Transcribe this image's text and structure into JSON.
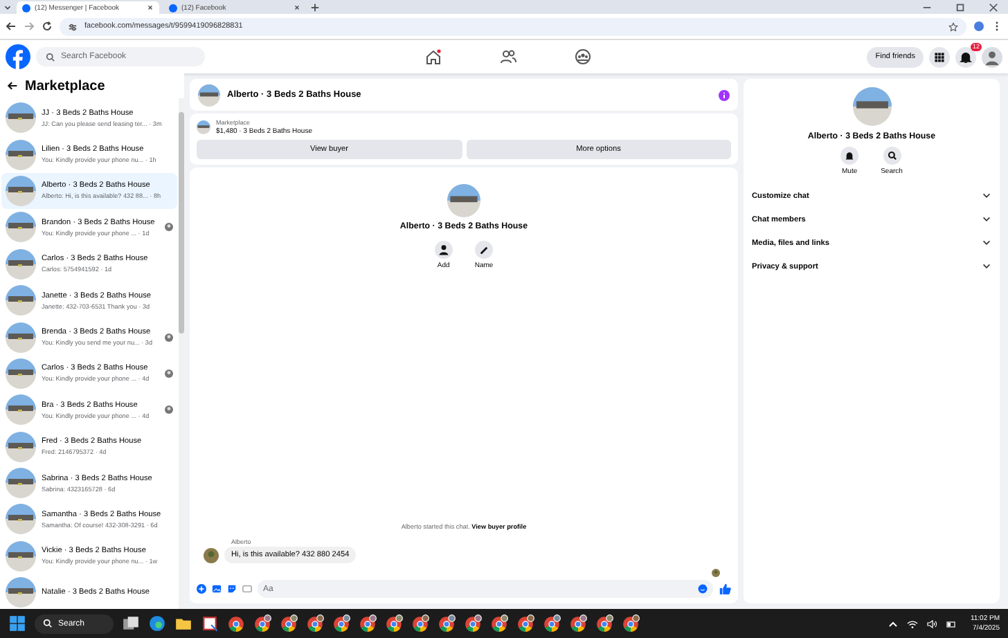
{
  "browser": {
    "tabs": [
      {
        "title": "(12) Messenger | Facebook",
        "selected": true
      },
      {
        "title": "(12) Facebook",
        "selected": false
      }
    ],
    "url": "facebook.com/messages/t/9599419096828831"
  },
  "topbar": {
    "search_placeholder": "Search Facebook",
    "find_friends": "Find friends",
    "notification_count": "12"
  },
  "sidebar": {
    "title": "Marketplace",
    "conversations": [
      {
        "title": "JJ · 3 Beds 2 Baths House",
        "preview": "JJ: Can you please send leasing ter... · 3m",
        "selected": false,
        "seen": false
      },
      {
        "title": "Lilien · 3 Beds 2 Baths House",
        "preview": "You: Kindly provide your phone nu... · 1h",
        "selected": false,
        "seen": false
      },
      {
        "title": "Alberto · 3 Beds 2 Baths House",
        "preview": "Alberto: Hi, is this available? 432 88... · 8h",
        "selected": true,
        "seen": false
      },
      {
        "title": "Brandon · 3 Beds 2 Baths House",
        "preview": "You: Kindly provide your phone ... · 1d",
        "selected": false,
        "seen": true
      },
      {
        "title": "Carlos · 3 Beds 2 Baths House",
        "preview": "Carlos: 5754941592 · 1d",
        "selected": false,
        "seen": false
      },
      {
        "title": "Janette · 3 Beds 2 Baths House",
        "preview": "Janette: 432-703-6531 Thank you · 3d",
        "selected": false,
        "seen": false
      },
      {
        "title": "Brenda · 3 Beds 2 Baths House",
        "preview": "You: Kindly you send me your nu... · 3d",
        "selected": false,
        "seen": true
      },
      {
        "title": "Carlos · 3 Beds 2 Baths House",
        "preview": "You: Kindly provide your phone ... · 4d",
        "selected": false,
        "seen": true
      },
      {
        "title": "Bra · 3 Beds 2 Baths House",
        "preview": "You: Kindly provide your phone ... · 4d",
        "selected": false,
        "seen": true
      },
      {
        "title": "Fred · 3 Beds 2 Baths House",
        "preview": "Fred: 2146795372 · 4d",
        "selected": false,
        "seen": false
      },
      {
        "title": "Sabrina · 3 Beds 2 Baths House",
        "preview": "Sabrina: 4323165728 · 6d",
        "selected": false,
        "seen": false
      },
      {
        "title": "Samantha · 3 Beds 2 Baths House",
        "preview": "Samantha: Of course! 432-308-3291 · 6d",
        "selected": false,
        "seen": false
      },
      {
        "title": "Vickie · 3 Beds 2 Baths House",
        "preview": "You: Kindly provide your phone nu... · 1w",
        "selected": false,
        "seen": false
      },
      {
        "title": "Natalie · 3 Beds 2 Baths House",
        "selected": false,
        "seen": false
      }
    ]
  },
  "chat": {
    "header": "Alberto · 3 Beds 2 Baths House",
    "listing_label": "Marketplace",
    "listing": "$1,480 · 3 Beds 2 Baths House",
    "buttons": [
      "View buyer",
      "More options"
    ],
    "profile_name": "Alberto · 3 Beds 2 Baths House",
    "actions": [
      "Add",
      "Name"
    ],
    "started": "Alberto started this chat.",
    "started_link": "View buyer profile",
    "sender": "Alberto",
    "message": "Hi, is this available? 432 880 2454",
    "input_placeholder": "Aa"
  },
  "details": {
    "name": "Alberto · 3 Beds 2 Baths House",
    "actions": [
      "Mute",
      "Search"
    ],
    "sections": [
      "Customize chat",
      "Chat members",
      "Media, files and links",
      "Privacy & support"
    ]
  },
  "taskbar": {
    "search": "Search",
    "time": "11:02 PM",
    "date": "7/4/2025"
  }
}
